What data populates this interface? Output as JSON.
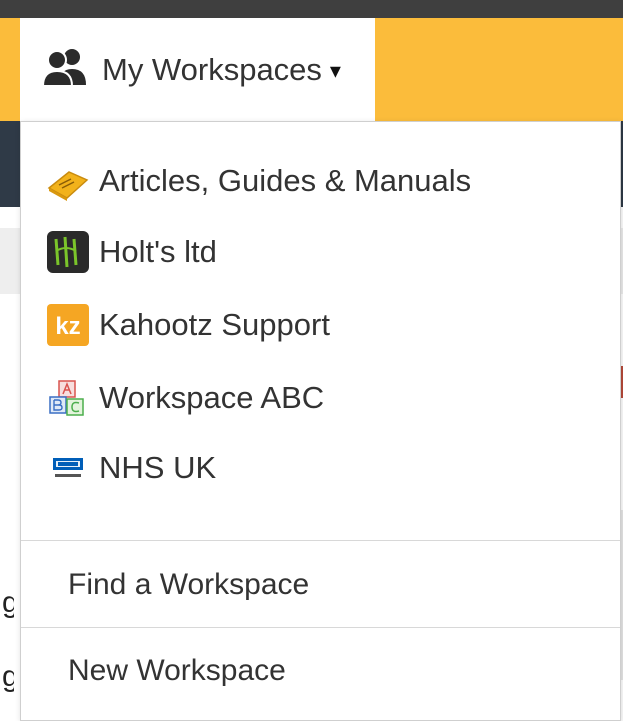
{
  "trigger": {
    "label": "My Workspaces",
    "caret": "▾",
    "icon": "users-icon"
  },
  "workspaces": [
    {
      "label": "Articles, Guides & Manuals",
      "icon": "book-icon"
    },
    {
      "label": "Holt's ltd",
      "icon": "monster-logo-icon"
    },
    {
      "label": "Kahootz Support",
      "icon": "kahootz-logo-icon",
      "badge_text": "kz"
    },
    {
      "label": "Workspace ABC",
      "icon": "abc-blocks-icon"
    },
    {
      "label": "NHS UK",
      "icon": "nhs-england-logo-icon"
    }
  ],
  "actions": {
    "find_label": "Find a Workspace",
    "new_label": "New Workspace"
  },
  "colors": {
    "accent_yellow": "#fbbc3b",
    "dark_band": "#2f3a47",
    "text": "#333333",
    "kahootz_orange": "#f5a623",
    "nhs_blue": "#005eb8"
  }
}
